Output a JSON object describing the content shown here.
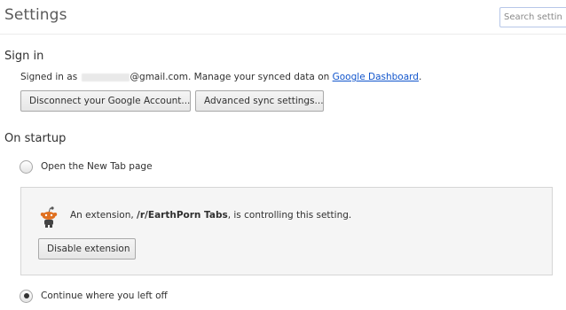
{
  "header": {
    "title": "Settings",
    "search_placeholder": "Search settings"
  },
  "sign_in": {
    "title": "Sign in",
    "signed_in_prefix": "Signed in as",
    "email_suffix": "@gmail.com.",
    "manage_text": "Manage your synced data on",
    "dashboard_link": "Google Dashboard",
    "period": ".",
    "disconnect_button": "Disconnect your Google Account...",
    "advanced_sync_button": "Advanced sync settings..."
  },
  "on_startup": {
    "title": "On startup",
    "options": [
      {
        "label": "Open the New Tab page",
        "checked": false
      },
      {
        "label": "Continue where you left off",
        "checked": true
      }
    ],
    "extension_notice": {
      "prefix": "An extension,",
      "extension_name": "/r/EarthPorn Tabs",
      "suffix": ", is controlling this setting.",
      "icon": "reddit-alien-icon",
      "disable_button": "Disable extension"
    }
  }
}
